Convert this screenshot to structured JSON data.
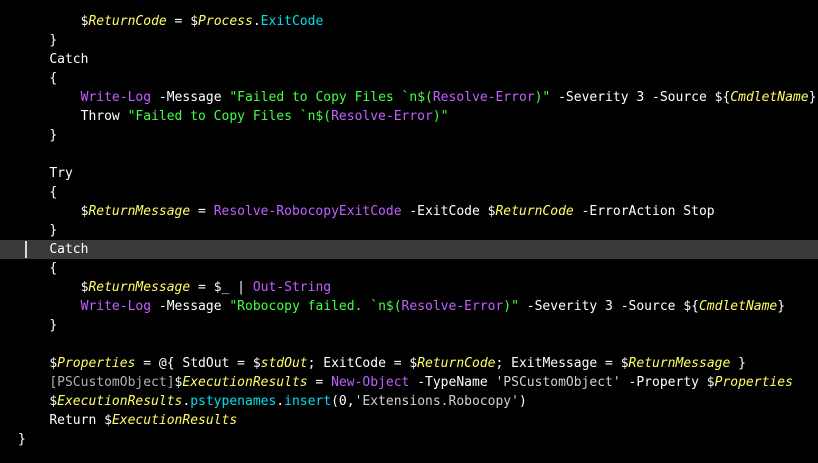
{
  "editor": {
    "current_line_index": 12,
    "colors": {
      "background": "#000000",
      "current_line": "#3a3a3a",
      "variable": "#ffff66",
      "property": "#00e0e8",
      "command": "#c060ff",
      "string": "#44ff44",
      "text": "#ffffff"
    },
    "lines": [
      {
        "indent": "        ",
        "tokens": [
          {
            "t": "$",
            "k": "plain"
          },
          {
            "t": "ReturnCode",
            "k": "variable"
          },
          {
            "t": " = ",
            "k": "plain"
          },
          {
            "t": "$",
            "k": "plain"
          },
          {
            "t": "Process",
            "k": "variable"
          },
          {
            "t": ".",
            "k": "plain"
          },
          {
            "t": "ExitCode",
            "k": "property"
          }
        ]
      },
      {
        "indent": "    ",
        "tokens": [
          {
            "t": "}",
            "k": "plain"
          }
        ]
      },
      {
        "indent": "    ",
        "tokens": [
          {
            "t": "Catch",
            "k": "keyword"
          }
        ]
      },
      {
        "indent": "    ",
        "tokens": [
          {
            "t": "{",
            "k": "plain"
          }
        ]
      },
      {
        "indent": "        ",
        "tokens": [
          {
            "t": "Write-Log",
            "k": "command"
          },
          {
            "t": " -Message ",
            "k": "plain"
          },
          {
            "t": "\"Failed to Copy Files `n$(",
            "k": "string"
          },
          {
            "t": "Resolve-Error",
            "k": "command"
          },
          {
            "t": ")\"",
            "k": "string"
          },
          {
            "t": " -Severity ",
            "k": "plain"
          },
          {
            "t": "3",
            "k": "number"
          },
          {
            "t": " -Source ",
            "k": "plain"
          },
          {
            "t": "${",
            "k": "plain"
          },
          {
            "t": "CmdletName",
            "k": "variable"
          },
          {
            "t": "}",
            "k": "plain"
          }
        ]
      },
      {
        "indent": "        ",
        "tokens": [
          {
            "t": "Throw ",
            "k": "keyword"
          },
          {
            "t": "\"Failed to Copy Files `n$(",
            "k": "string"
          },
          {
            "t": "Resolve-Error",
            "k": "command"
          },
          {
            "t": ")\"",
            "k": "string"
          }
        ]
      },
      {
        "indent": "    ",
        "tokens": [
          {
            "t": "}",
            "k": "plain"
          }
        ]
      },
      {
        "indent": "",
        "tokens": []
      },
      {
        "indent": "    ",
        "tokens": [
          {
            "t": "Try",
            "k": "keyword"
          }
        ]
      },
      {
        "indent": "    ",
        "tokens": [
          {
            "t": "{",
            "k": "plain"
          }
        ]
      },
      {
        "indent": "        ",
        "tokens": [
          {
            "t": "$",
            "k": "plain"
          },
          {
            "t": "ReturnMessage",
            "k": "variable"
          },
          {
            "t": " = ",
            "k": "plain"
          },
          {
            "t": "Resolve-RobocopyExitCode",
            "k": "command"
          },
          {
            "t": " -ExitCode ",
            "k": "plain"
          },
          {
            "t": "$",
            "k": "plain"
          },
          {
            "t": "ReturnCode",
            "k": "variable"
          },
          {
            "t": " -ErrorAction Stop",
            "k": "plain"
          }
        ]
      },
      {
        "indent": "    ",
        "tokens": [
          {
            "t": "}",
            "k": "plain"
          }
        ]
      },
      {
        "indent": "    ",
        "tokens": [
          {
            "t": "Catch",
            "k": "keyword"
          }
        ]
      },
      {
        "indent": "    ",
        "tokens": [
          {
            "t": "{",
            "k": "plain"
          }
        ]
      },
      {
        "indent": "        ",
        "tokens": [
          {
            "t": "$",
            "k": "plain"
          },
          {
            "t": "ReturnMessage",
            "k": "variable"
          },
          {
            "t": " = ",
            "k": "plain"
          },
          {
            "t": "$_",
            "k": "plain"
          },
          {
            "t": " | ",
            "k": "plain"
          },
          {
            "t": "Out-String",
            "k": "command"
          }
        ]
      },
      {
        "indent": "        ",
        "tokens": [
          {
            "t": "Write-Log",
            "k": "command"
          },
          {
            "t": " -Message ",
            "k": "plain"
          },
          {
            "t": "\"Robocopy failed. `n$(",
            "k": "string"
          },
          {
            "t": "Resolve-Error",
            "k": "command"
          },
          {
            "t": ")\"",
            "k": "string"
          },
          {
            "t": " -Severity ",
            "k": "plain"
          },
          {
            "t": "3",
            "k": "number"
          },
          {
            "t": " -Source ",
            "k": "plain"
          },
          {
            "t": "${",
            "k": "plain"
          },
          {
            "t": "CmdletName",
            "k": "variable"
          },
          {
            "t": "}",
            "k": "plain"
          }
        ]
      },
      {
        "indent": "    ",
        "tokens": [
          {
            "t": "}",
            "k": "plain"
          }
        ]
      },
      {
        "indent": "",
        "tokens": []
      },
      {
        "indent": "    ",
        "tokens": [
          {
            "t": "$",
            "k": "plain"
          },
          {
            "t": "Properties",
            "k": "variable"
          },
          {
            "t": " = @{ StdOut = ",
            "k": "plain"
          },
          {
            "t": "$",
            "k": "plain"
          },
          {
            "t": "stdOut",
            "k": "variable"
          },
          {
            "t": "; ExitCode = ",
            "k": "plain"
          },
          {
            "t": "$",
            "k": "plain"
          },
          {
            "t": "ReturnCode",
            "k": "variable"
          },
          {
            "t": "; ExitMessage = ",
            "k": "plain"
          },
          {
            "t": "$",
            "k": "plain"
          },
          {
            "t": "ReturnMessage",
            "k": "variable"
          },
          {
            "t": " }",
            "k": "plain"
          }
        ]
      },
      {
        "indent": "    ",
        "tokens": [
          {
            "t": "[PSCustomObject]",
            "k": "type"
          },
          {
            "t": "$",
            "k": "plain"
          },
          {
            "t": "ExecutionResults",
            "k": "variable"
          },
          {
            "t": " = ",
            "k": "plain"
          },
          {
            "t": "New-Object",
            "k": "command"
          },
          {
            "t": " -TypeName ",
            "k": "plain"
          },
          {
            "t": "'PSCustomObject'",
            "k": "sstring"
          },
          {
            "t": " -Property ",
            "k": "plain"
          },
          {
            "t": "$",
            "k": "plain"
          },
          {
            "t": "Properties",
            "k": "variable"
          }
        ]
      },
      {
        "indent": "    ",
        "tokens": [
          {
            "t": "$",
            "k": "plain"
          },
          {
            "t": "ExecutionResults",
            "k": "variable"
          },
          {
            "t": ".",
            "k": "plain"
          },
          {
            "t": "pstypenames",
            "k": "property"
          },
          {
            "t": ".",
            "k": "plain"
          },
          {
            "t": "insert",
            "k": "property"
          },
          {
            "t": "(0,",
            "k": "plain"
          },
          {
            "t": "'Extensions.Robocopy'",
            "k": "sstring"
          },
          {
            "t": ")",
            "k": "plain"
          }
        ]
      },
      {
        "indent": "    ",
        "tokens": [
          {
            "t": "Return ",
            "k": "keyword"
          },
          {
            "t": "$",
            "k": "plain"
          },
          {
            "t": "ExecutionResults",
            "k": "variable"
          }
        ]
      },
      {
        "indent": "",
        "tokens": [
          {
            "t": "}",
            "k": "plain"
          }
        ]
      }
    ]
  }
}
